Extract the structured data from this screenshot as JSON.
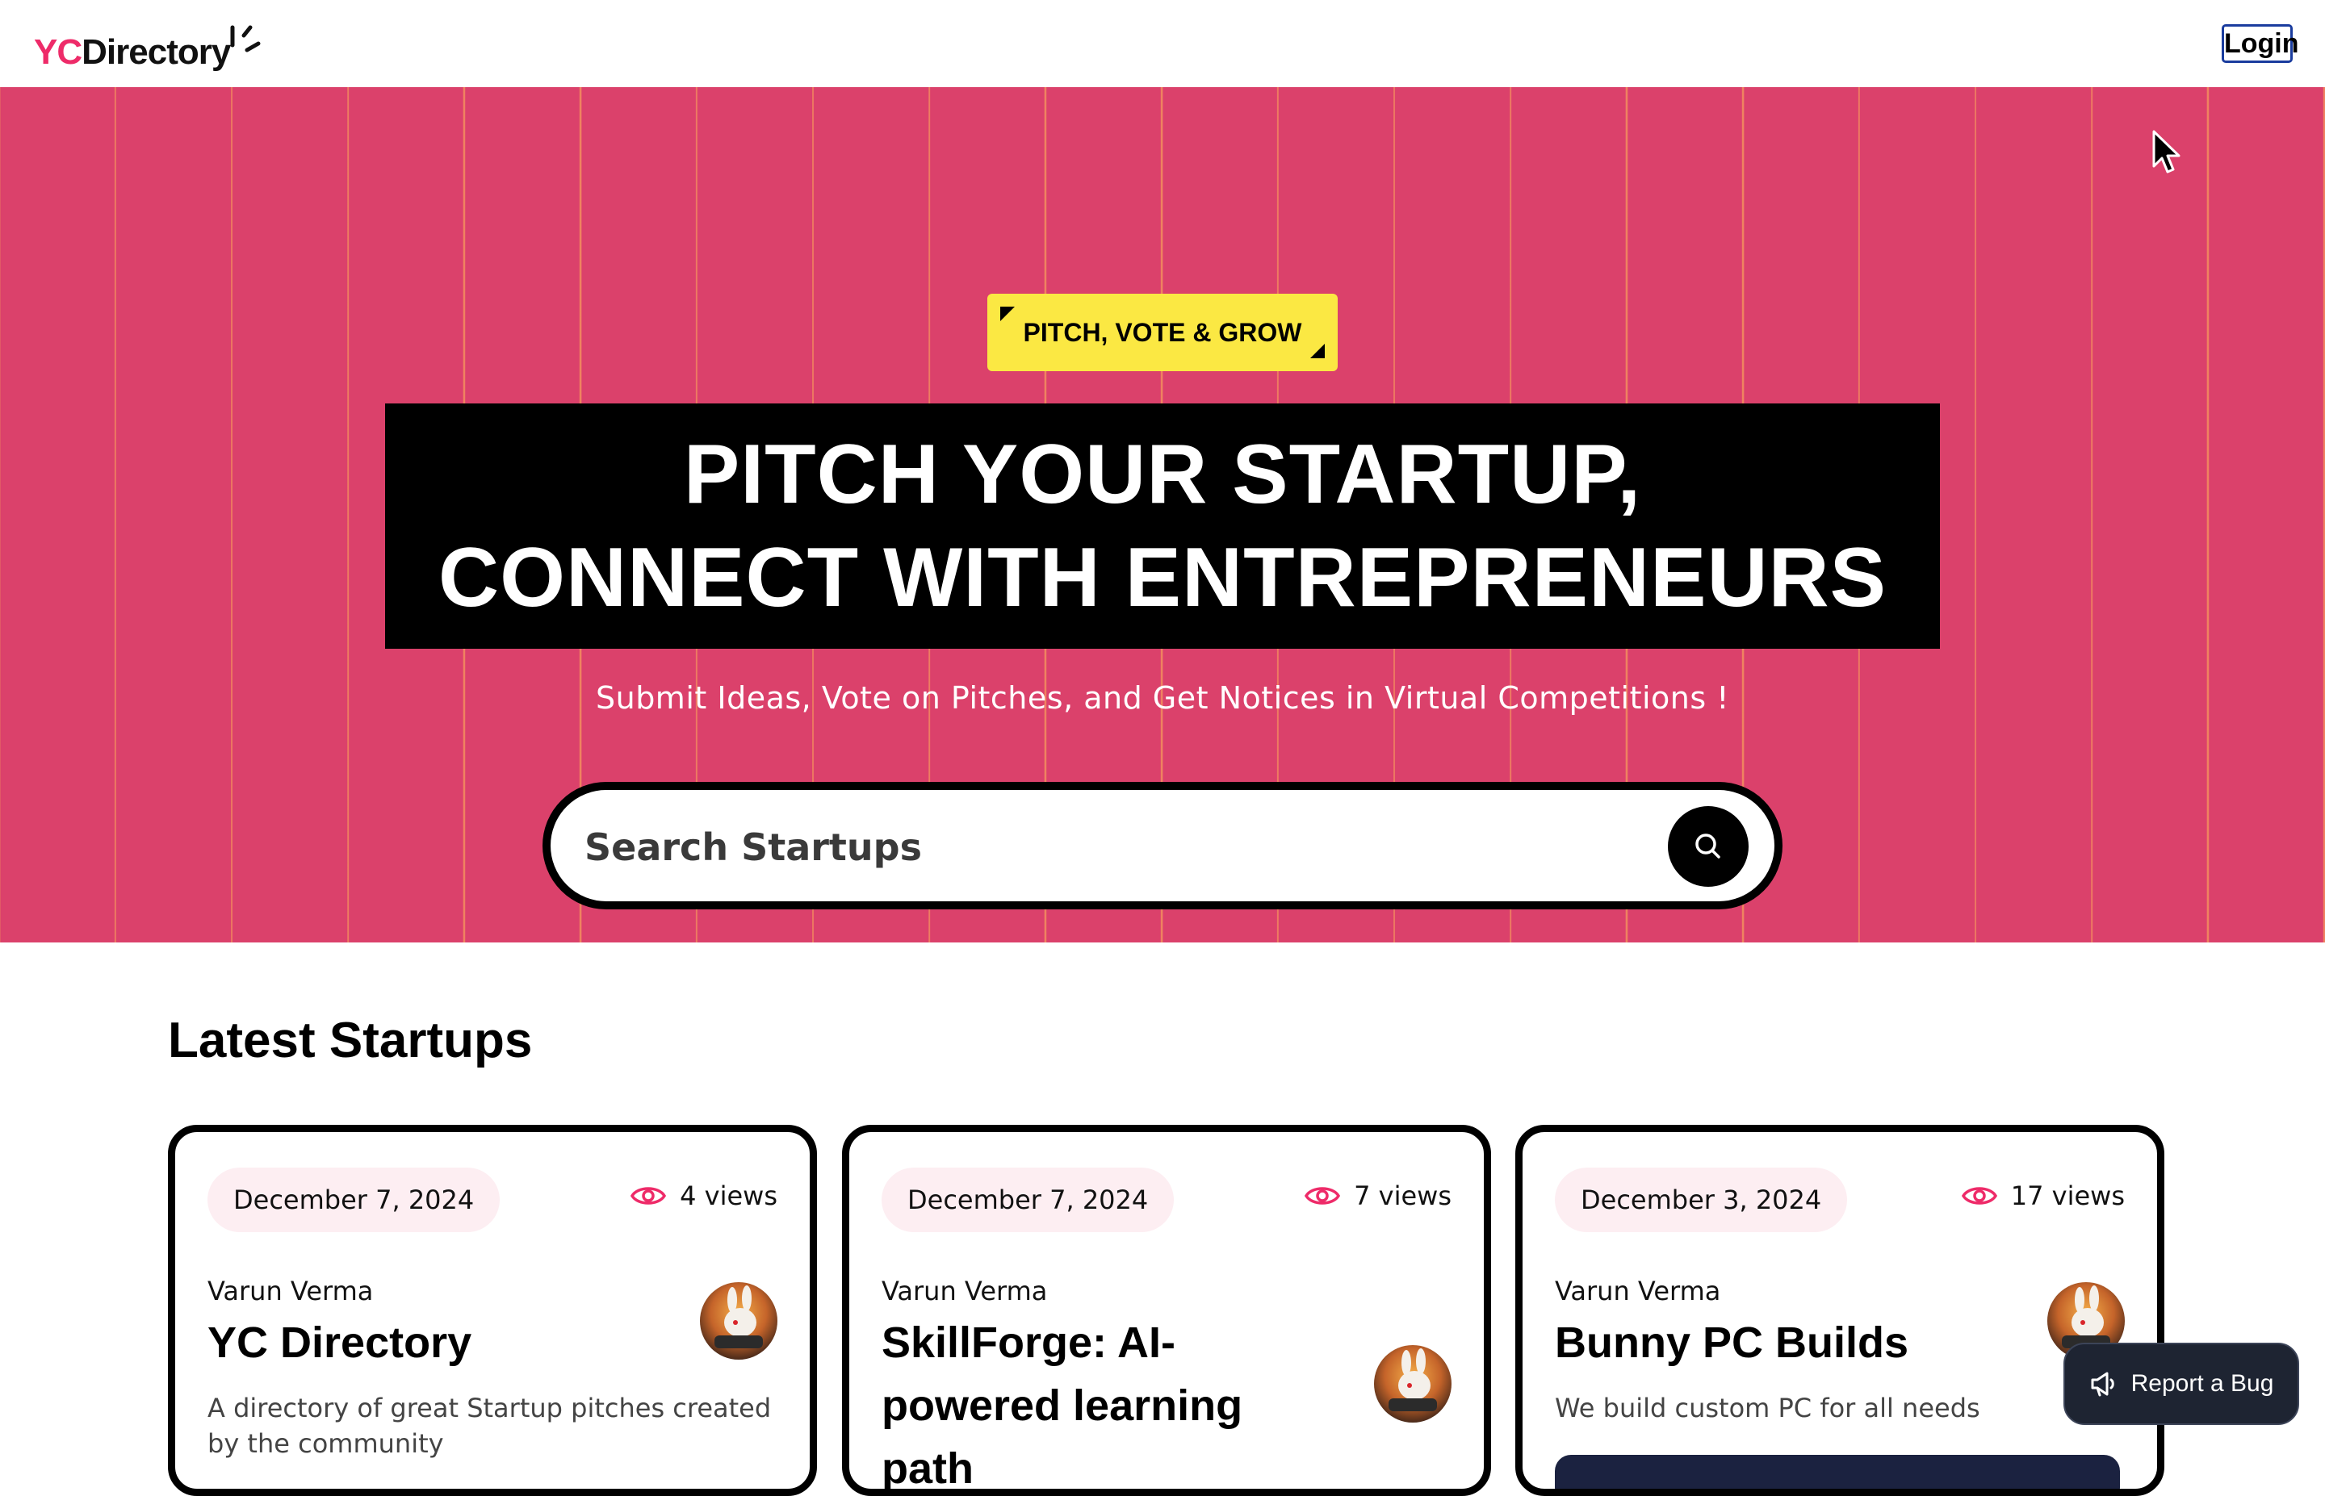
{
  "header": {
    "logo_primary": "YC",
    "logo_secondary": "Directory",
    "login_label": "Login"
  },
  "hero": {
    "tag": "PITCH, VOTE & GROW",
    "heading_line1": "PITCH YOUR STARTUP,",
    "heading_line2": "CONNECT WITH ENTREPRENEURS",
    "subheading": "Submit Ideas, Vote on Pitches, and Get Notices in Virtual Competitions !",
    "search_placeholder": "Search Startups",
    "search_icon": "search-icon"
  },
  "section": {
    "title": "Latest Startups"
  },
  "cards": [
    {
      "date": "December 7, 2024",
      "views": "4 views",
      "author": "Varun Verma",
      "title": "YC Directory",
      "description": "A directory of great Startup pitches created by the community"
    },
    {
      "date": "December 7, 2024",
      "views": "7 views",
      "author": "Varun Verma",
      "title": "SkillForge: AI-powered learning path",
      "description": ""
    },
    {
      "date": "December 3, 2024",
      "views": "17 views",
      "author": "Varun Verma",
      "title": "Bunny PC Builds",
      "description": "We build custom PC for all needs"
    }
  ],
  "report_bug": {
    "label": "Report a Bug",
    "icon": "megaphone-icon"
  },
  "colors": {
    "brand_pink": "#EE2B69",
    "hero_bg": "#DB416B",
    "tag_yellow": "#FBE843",
    "grid_line": "#FFB757",
    "date_pill_bg": "#FDEEF2",
    "button_dark": "#1E2432"
  }
}
